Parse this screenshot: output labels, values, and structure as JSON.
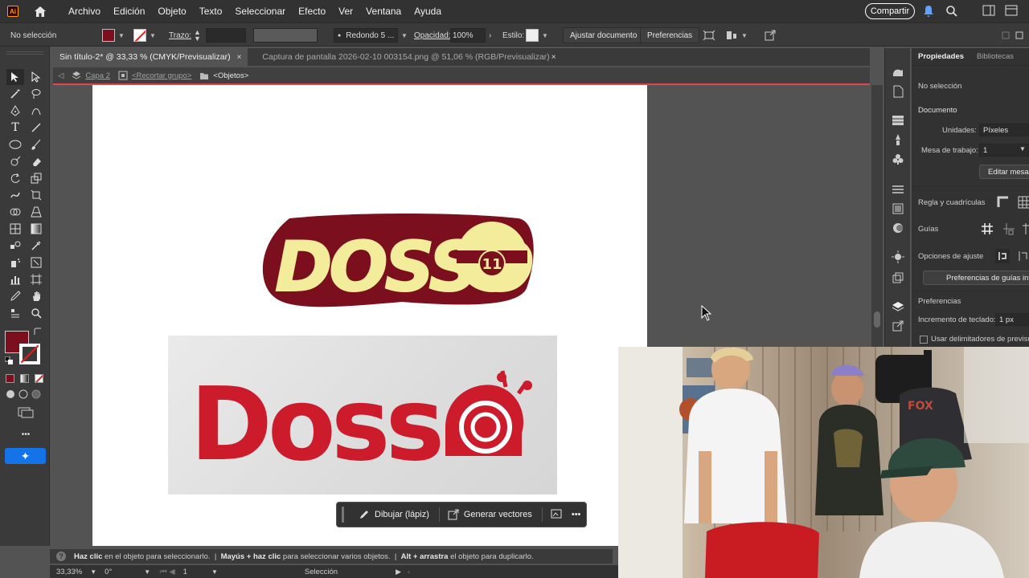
{
  "menubar": {
    "app_badge": "Ai",
    "items": [
      "Archivo",
      "Edición",
      "Objeto",
      "Texto",
      "Seleccionar",
      "Efecto",
      "Ver",
      "Ventana",
      "Ayuda"
    ],
    "share_label": "Compartir"
  },
  "controlbar": {
    "selection_status": "No selección",
    "fill_color": "#7c0f1e",
    "stroke_label": "Trazo:",
    "brush_label": "Redondo 5 ...",
    "opacity_label": "Opacidad:",
    "opacity_value": "100%",
    "style_label": "Estilo:",
    "adjust_doc_label": "Ajustar documento",
    "preferences_label": "Preferencias"
  },
  "tabs": [
    {
      "label": "Sin título-2* @ 33,33 % (CMYK/Previsualizar)",
      "close": "×"
    },
    {
      "label": "Captura de pantalla 2026-02-10 003154.png @ 51,06 % (RGB/Previsualizar)",
      "close": "×"
    }
  ],
  "breadcrumb": {
    "layer": "Capa 2",
    "group": "<Recortar grupo>",
    "current": "<Objetos>"
  },
  "artwork": {
    "logo_top_text": "DOSSO",
    "logo_top_badge": "11",
    "logo_top_colors": {
      "fill": "#f3ec9b",
      "outline": "#7c0f1e"
    },
    "logo_ref_text": "Doss",
    "logo_ref_color": "#cc1b2b"
  },
  "context_bar": {
    "draw_label": "Dibujar (lápiz)",
    "generate_label": "Generar vectores",
    "more_label": "•••"
  },
  "hint": {
    "p1_bold": "Haz clic",
    "p1": " en el objeto para seleccionarlo.",
    "p2_bold": "Mayús + haz clic",
    "p2": " para seleccionar varios objetos.",
    "p3_bold": "Alt + arrastra",
    "p3": " el objeto para duplicarlo."
  },
  "statusbar": {
    "zoom": "33,33%",
    "rotation": "0°",
    "artboard_num": "1",
    "mode": "Selección"
  },
  "properties": {
    "tabs": [
      "Propiedades",
      "Bibliotecas"
    ],
    "no_selection": "No selección",
    "document_header": "Documento",
    "units_label": "Unidades:",
    "units_value": "Píxeles",
    "artboard_label": "Mesa de trabajo:",
    "artboard_value": "1",
    "edit_artboards": "Editar mesas",
    "rulers_label": "Regla y cuadrículas",
    "guides_label": "Guías",
    "snap_label": "Opciones de ajuste",
    "smart_guides_btn": "Preferencias de guías inteli",
    "prefs_header": "Preferencias",
    "keyboard_inc_label": "Incremento de teclado:",
    "keyboard_inc_value": "1 px",
    "preview_bounds_label": "Usar delimitadores de previsual"
  },
  "toolbar": {
    "more_label": "•••"
  }
}
